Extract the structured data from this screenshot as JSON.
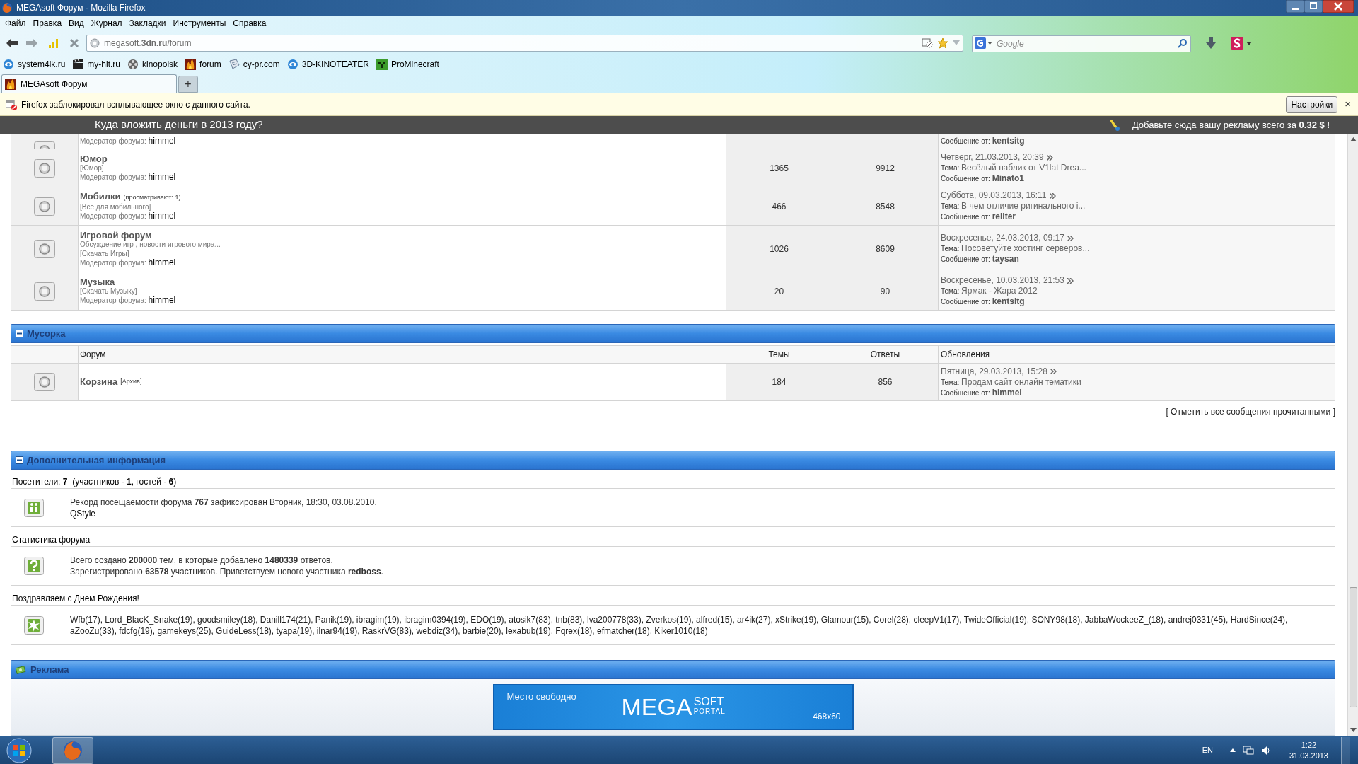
{
  "window": {
    "title": "MEGAsoft Форум - Mozilla Firefox"
  },
  "menu": [
    "Файл",
    "Правка",
    "Вид",
    "Журнал",
    "Закладки",
    "Инструменты",
    "Справка"
  ],
  "address": {
    "value": "megasoft.**3dn.ru**/forum"
  },
  "search": {
    "placeholder": "Google"
  },
  "bookmarks": [
    {
      "label": "system4ik.ru",
      "kind": "eye"
    },
    {
      "label": "my-hit.ru",
      "kind": "clapper"
    },
    {
      "label": "kinopoisk",
      "kind": "reel"
    },
    {
      "label": "forum",
      "kind": "flame"
    },
    {
      "label": "cy-pr.com",
      "kind": "pencil"
    },
    {
      "label": "3D-KINOTEATER",
      "kind": "eye"
    },
    {
      "label": "ProMinecraft",
      "kind": "block"
    }
  ],
  "tabs": [
    {
      "label": "MEGAsoft Форум",
      "selected": true
    }
  ],
  "new_tab": "+",
  "notification": {
    "text": "Firefox заблокировал всплывающее окно с данного сайта.",
    "button": "Настройки",
    "close": "×"
  },
  "ad_bar": {
    "left": "Куда вложить деньги в 2013 году?",
    "right": "Добавьте сюда вашу рекламу всего за **0.32 $** !"
  },
  "partial_row": {
    "moderator_label": "Модератор форума:",
    "moderator": "himmel",
    "author_label": "Сообщение от:",
    "author": "kentsitg"
  },
  "forums": [
    {
      "name": "Юмор",
      "lines": [
        "[Юмор]"
      ],
      "moderator_label": "Модератор форума:",
      "moderator": "himmel",
      "topics": "1365",
      "replies": "9912",
      "date": "Четверг, 21.03.2013, 20:39",
      "topic_label": "Тема:",
      "topic": "Весёлый паблик от V1lat Drea...",
      "author_label": "Сообщение от:",
      "author": "Minato1"
    },
    {
      "name": "Мобилки",
      "viewing": "(просматривают: 1)",
      "lines": [
        "[Все для мобильного]"
      ],
      "moderator_label": "Модератор форума:",
      "moderator": "himmel",
      "topics": "466",
      "replies": "8548",
      "date": "Суббота, 09.03.2013, 16:11",
      "topic_label": "Тема:",
      "topic": "В чем отличие ригинального i...",
      "author_label": "Сообщение от:",
      "author": "rellter"
    },
    {
      "name": "Игровой форум",
      "lines": [
        "Обсуждение игр , новости игрового мира...",
        "[Скачать Игры]"
      ],
      "moderator_label": "Модератор форума:",
      "moderator": "himmel",
      "topics": "1026",
      "replies": "8609",
      "date": "Воскресенье, 24.03.2013, 09:17",
      "topic_label": "Тема:",
      "topic": "Посоветуйте хостинг серверов...",
      "author_label": "Сообщение от:",
      "author": "taysan"
    },
    {
      "name": "Музыка",
      "lines": [
        "[Скачать Музыку]"
      ],
      "moderator_label": "Модератор форума:",
      "moderator": "himmel",
      "topics": "20",
      "replies": "90",
      "date": "Воскресенье, 10.03.2013, 21:53",
      "topic_label": "Тема:",
      "topic": "Ярмак - Жара 2012",
      "author_label": "Сообщение от:",
      "author": "kentsitg"
    }
  ],
  "trash": {
    "title": "Мусорка",
    "columns": [
      "Форум",
      "Темы",
      "Ответы",
      "Обновления"
    ],
    "rows": [
      {
        "name": "Корзина",
        "tag": "[Архив]",
        "topics": "184",
        "replies": "856",
        "date": "Пятница, 29.03.2013, 15:28",
        "topic_label": "Тема:",
        "topic": "Продам сайт онлайн тематики",
        "author_label": "Сообщение от:",
        "author": "himmel"
      }
    ]
  },
  "mark_read": "[ Отметить все сообщения прочитанными ]",
  "info": {
    "title": "Дополнительная информация",
    "visitors": "Посетители: **7**  (участников - **1**, гостей - **6**)",
    "record": "Рекорд посещаемости форума **767** зафиксирован Вторник, 18:30, 03.08.2010.",
    "record_user": "QStyle",
    "stats_title": "Статистика форума",
    "stats": [
      "Всего создано **200000** тем, в которые добавлено **1480339** ответов.",
      "Зарегистрировано **63578** участников. Приветствуем нового участника **redboss**."
    ],
    "birthday_title": "Поздравляем с Днем Рождения!",
    "birthdays": "Wfb(17), Lord_BlacK_Snake(19), goodsmiley(18), Danill174(21), Panik(19), ibragim(19), ibragim0394(19), EDO(19), atosik7(83), tnb(83), lva200778(33), Zverkos(19), alfred(15), ar4ik(27), xStrike(19), Glamour(15), Corel(28), cleepV1(17), TwideOfficial(19), SONY98(18), JabbaWockeeZ_(18), andrej0331(45), HardSince(24), aZooZu(33), fdcfg(19), gamekeys(25), GuideLess(18), tyapa(19), ilnar94(19), RaskrVG(83), webdiz(34), barbie(20), lexabub(19), Fqrex(18), efmatcher(18), Kiker1010(18)"
  },
  "ads": {
    "title": "Реклама",
    "banner": {
      "text": "Место свободно",
      "logo": "MEGA",
      "logo_top": "SOFT",
      "logo_bottom": "PORTAL",
      "size": "468x60"
    }
  },
  "taskbar": {
    "lang": "EN",
    "time": "1:22",
    "date": "31.03.2013"
  }
}
